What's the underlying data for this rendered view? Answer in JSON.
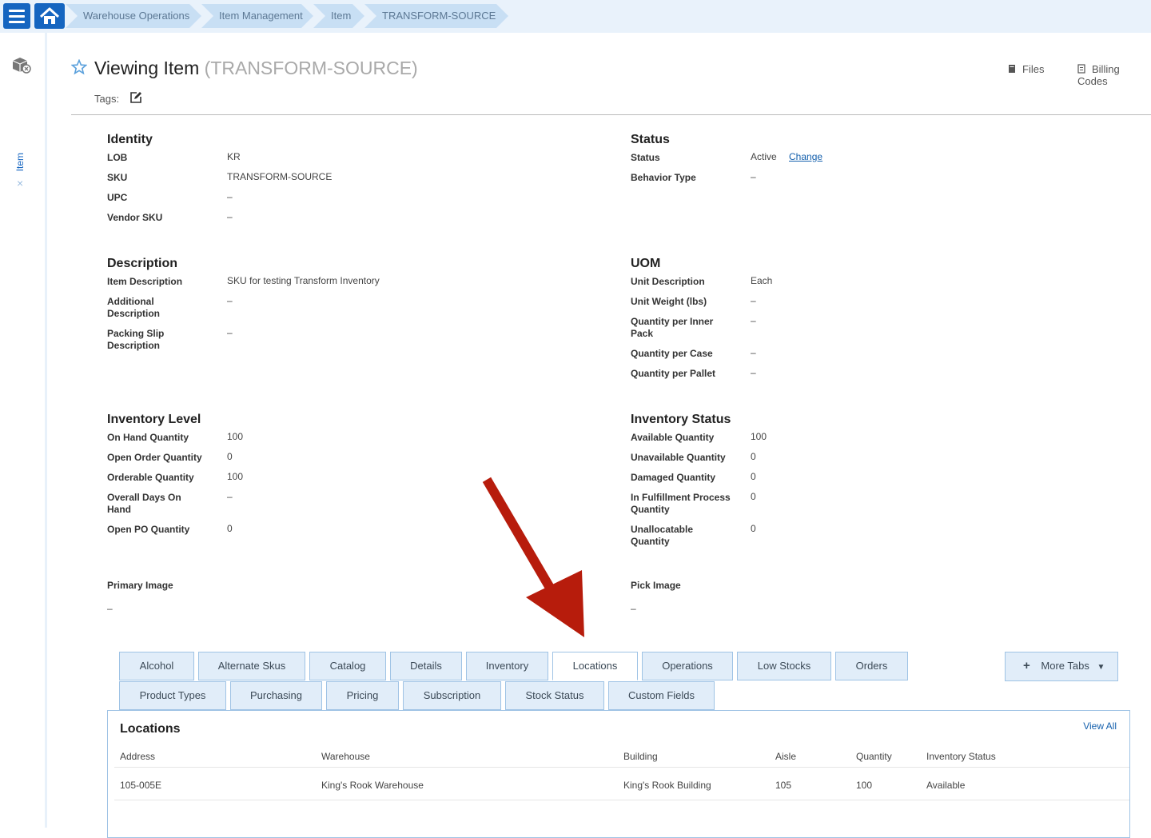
{
  "breadcrumb": {
    "items": [
      "Warehouse Operations",
      "Item Management",
      "Item",
      "TRANSFORM-SOURCE"
    ]
  },
  "sidenav": {
    "item_label": "Item",
    "close_symbol": "×"
  },
  "header": {
    "title": "Viewing Item",
    "subtitle": "(TRANSFORM-SOURCE)",
    "tags_label": "Tags:",
    "files_label": "Files",
    "billing_label": "Billing Codes"
  },
  "identity": {
    "title": "Identity",
    "rows": [
      {
        "label": "LOB",
        "value": "KR"
      },
      {
        "label": "SKU",
        "value": "TRANSFORM-SOURCE"
      },
      {
        "label": "UPC",
        "value": "–"
      },
      {
        "label": "Vendor SKU",
        "value": "–"
      }
    ]
  },
  "status": {
    "title": "Status",
    "rows": [
      {
        "label": "Status",
        "value": "Active",
        "action": "Change"
      },
      {
        "label": "Behavior Type",
        "value": "–"
      }
    ]
  },
  "description": {
    "title": "Description",
    "rows": [
      {
        "label": "Item Description",
        "value": "SKU for testing Transform Inventory"
      },
      {
        "label": "Additional Description",
        "value": "–"
      },
      {
        "label": "Packing Slip Description",
        "value": "–"
      }
    ]
  },
  "uom": {
    "title": "UOM",
    "rows": [
      {
        "label": "Unit Description",
        "value": "Each"
      },
      {
        "label": "Unit Weight (lbs)",
        "value": "–"
      },
      {
        "label": "Quantity per Inner Pack",
        "value": "–"
      },
      {
        "label": "Quantity per Case",
        "value": "–"
      },
      {
        "label": "Quantity per Pallet",
        "value": "–"
      }
    ]
  },
  "inventory_level": {
    "title": "Inventory Level",
    "rows": [
      {
        "label": "On Hand Quantity",
        "value": "100"
      },
      {
        "label": "Open Order Quantity",
        "value": "0"
      },
      {
        "label": "Orderable Quantity",
        "value": "100"
      },
      {
        "label": "Overall Days On Hand",
        "value": "–"
      },
      {
        "label": "Open PO Quantity",
        "value": "0"
      }
    ]
  },
  "inventory_status": {
    "title": "Inventory Status",
    "rows": [
      {
        "label": "Available Quantity",
        "value": "100"
      },
      {
        "label": "Unavailable Quantity",
        "value": "0"
      },
      {
        "label": "Damaged Quantity",
        "value": "0"
      },
      {
        "label": "In Fulfillment Process Quantity",
        "value": "0"
      },
      {
        "label": "Unallocatable Quantity",
        "value": "0"
      }
    ]
  },
  "images": {
    "primary_label": "Primary Image",
    "primary_value": "–",
    "pick_label": "Pick Image",
    "pick_value": "–"
  },
  "tabs": {
    "row1": [
      "Alcohol",
      "Alternate Skus",
      "Catalog",
      "Details",
      "Inventory",
      "Locations",
      "Operations",
      "Low Stocks",
      "Orders"
    ],
    "row2": [
      "Product Types",
      "Purchasing",
      "Pricing",
      "Subscription",
      "Stock Status",
      "Custom Fields"
    ],
    "active": "Locations",
    "more_tabs_label": "More Tabs"
  },
  "locations": {
    "title": "Locations",
    "view_all": "View All",
    "columns": [
      "Address",
      "Warehouse",
      "Building",
      "Aisle",
      "Quantity",
      "Inventory Status"
    ],
    "rows": [
      [
        "105-005E",
        "King's Rook Warehouse",
        "King's Rook Building",
        "105",
        "100",
        "Available"
      ]
    ]
  },
  "colors": {
    "accent": "#1565c0",
    "link": "#1560ad",
    "tab_bg": "#e1edf9",
    "annotation_arrow": "#b71c0c"
  }
}
